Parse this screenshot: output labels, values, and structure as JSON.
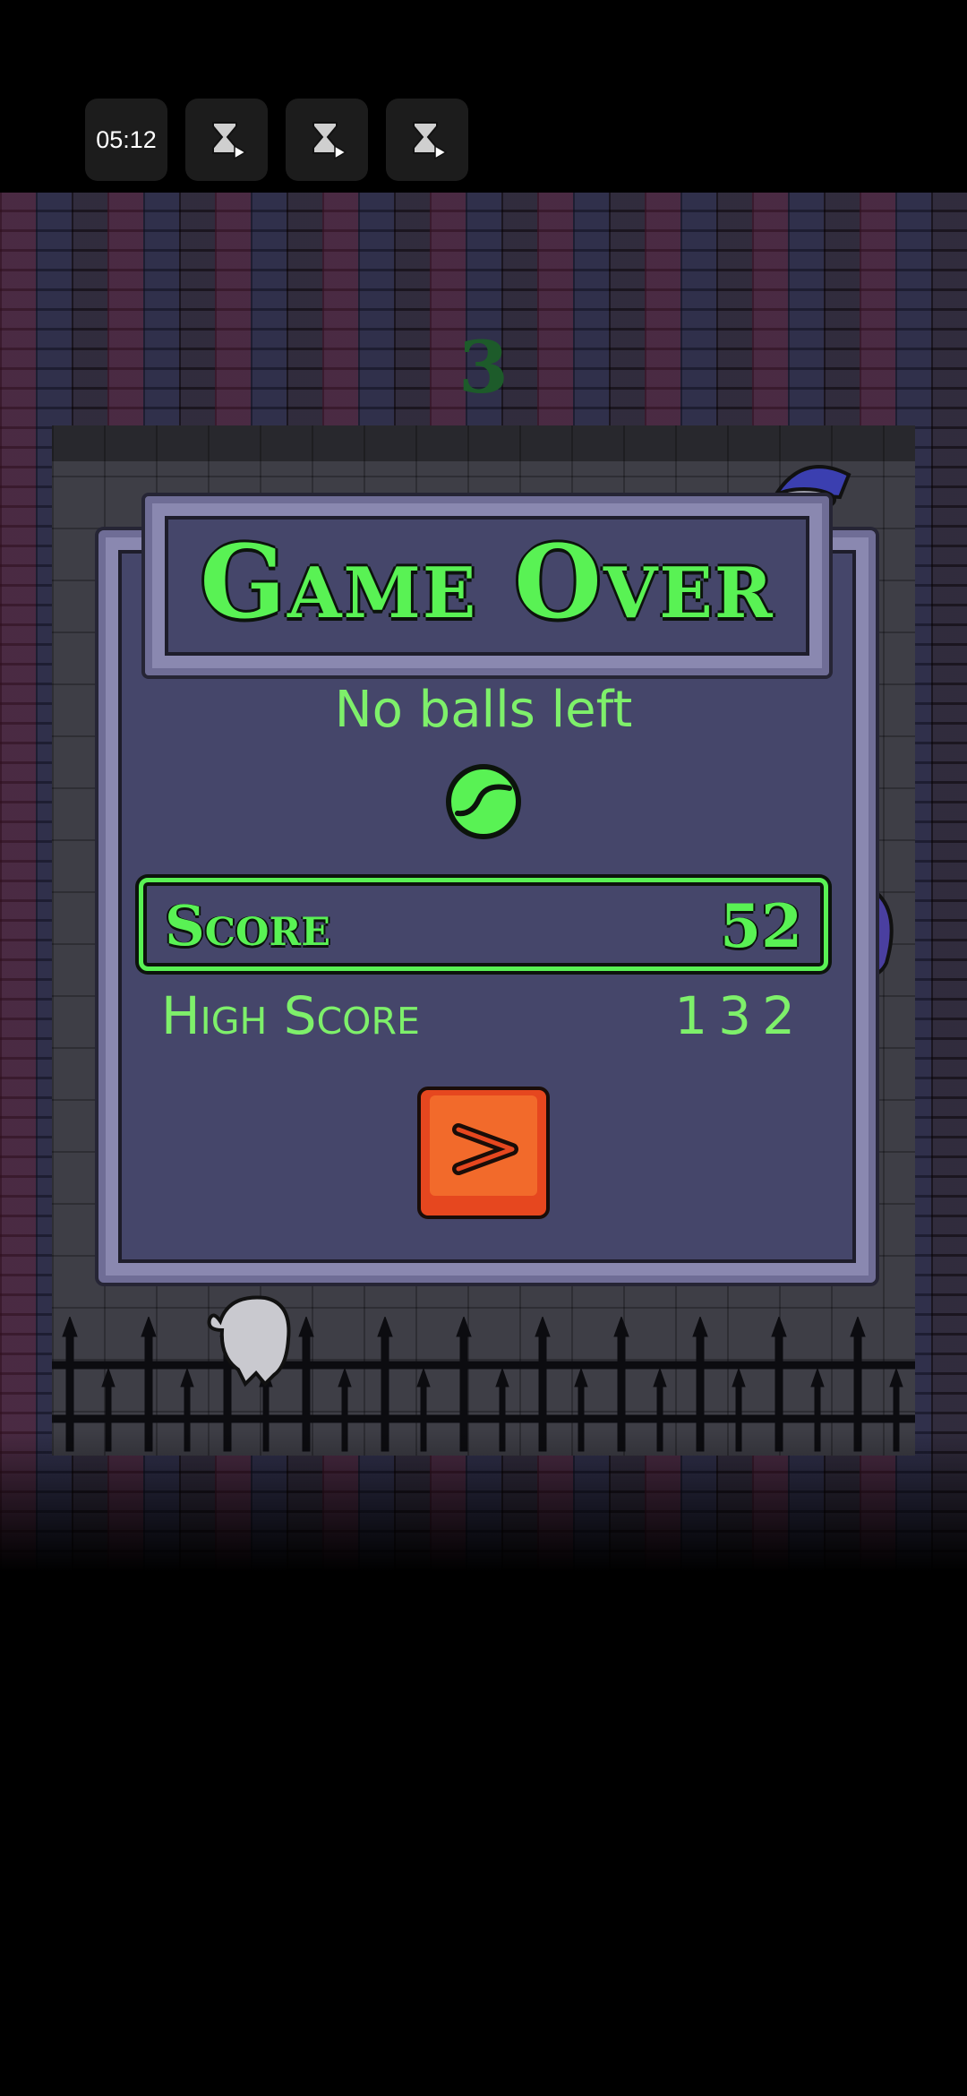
{
  "status_bar": {
    "time": "05:12",
    "icons": [
      "hourglass-play-icon",
      "hourglass-play-icon",
      "hourglass-play-icon"
    ]
  },
  "game": {
    "background_number": "3"
  },
  "game_over": {
    "title": "Game Over",
    "subtitle": "No balls left",
    "ball_icon": "tennis-ball-icon",
    "score_label": "Score",
    "score_value": "52",
    "high_score_label": "High Score",
    "high_score_value": "132",
    "next_button_icon": "chevron-right-icon"
  },
  "colors": {
    "accent_green": "#59f254",
    "panel": "#45466a",
    "panel_frame": "#8a88b0",
    "button": "#f26a2b"
  }
}
